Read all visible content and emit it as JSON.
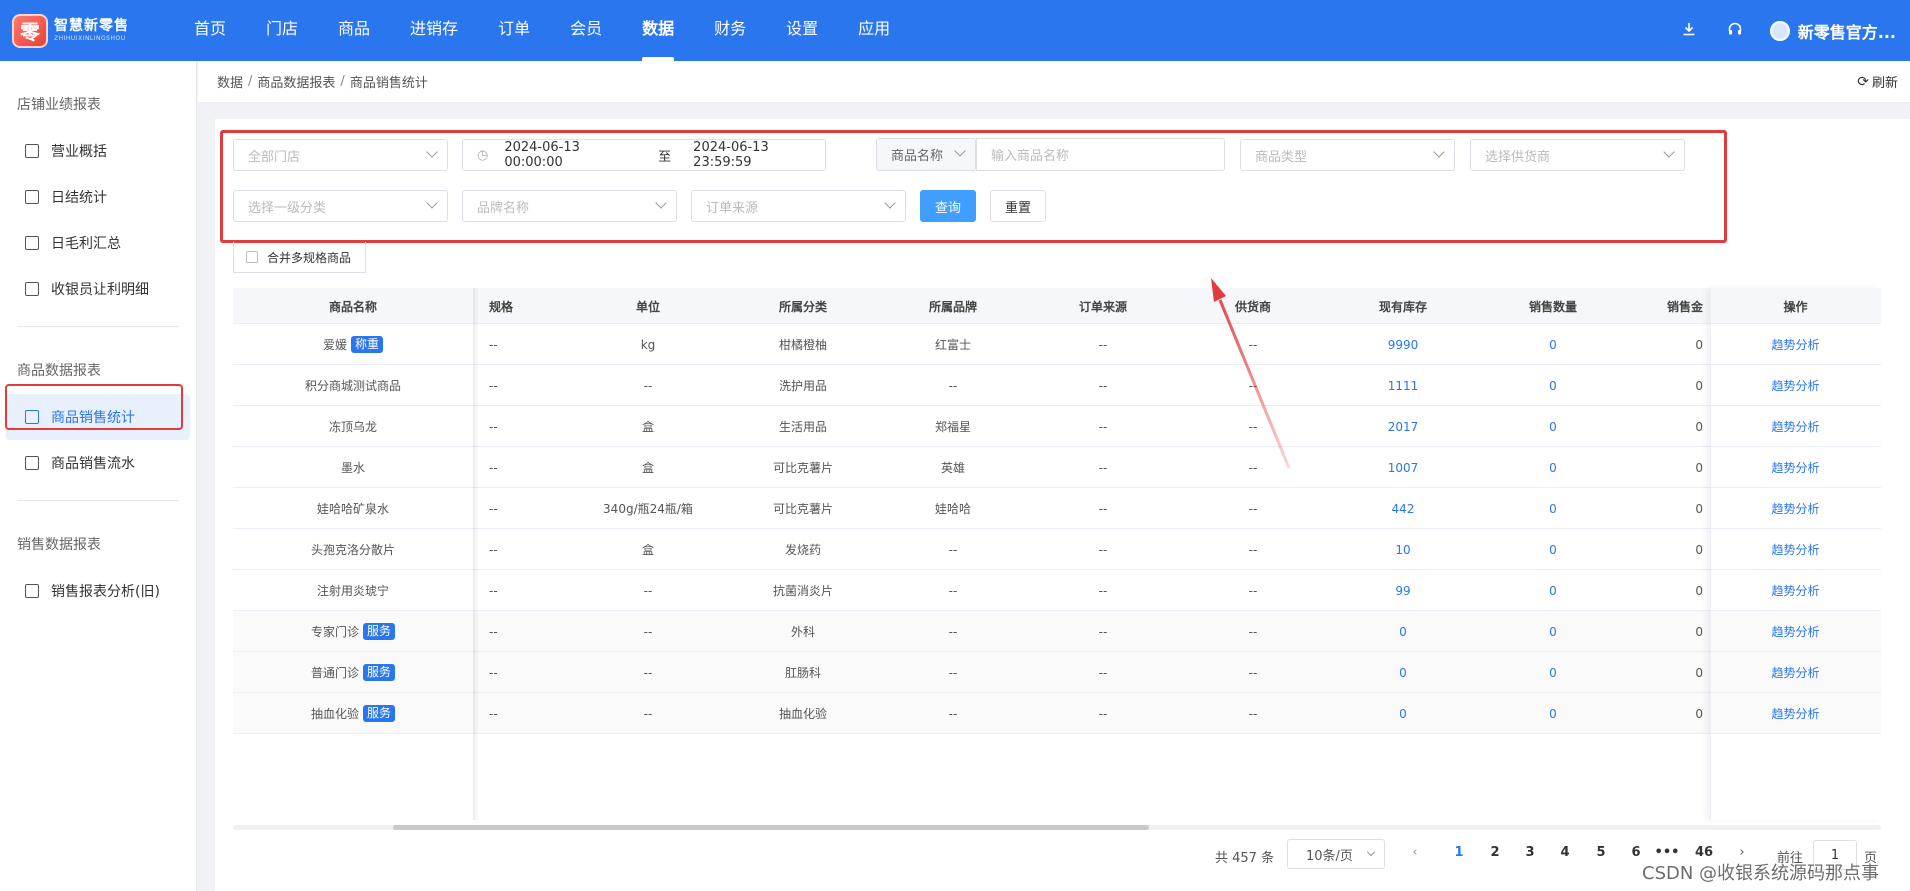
{
  "logo": {
    "badge": "零",
    "name_cn": "智慧新零售",
    "name_en": "ZHIHUIXINLINGSHOU"
  },
  "nav": [
    {
      "label": "首页"
    },
    {
      "label": "门店"
    },
    {
      "label": "商品"
    },
    {
      "label": "进销存"
    },
    {
      "label": "订单"
    },
    {
      "label": "会员"
    },
    {
      "label": "数据"
    },
    {
      "label": "财务"
    },
    {
      "label": "设置"
    },
    {
      "label": "应用"
    }
  ],
  "active_nav": "数据",
  "topright": {
    "download_icon": "download-icon",
    "support_icon": "headset-icon",
    "user_name": "新零售官方..."
  },
  "sidebar": {
    "group1": "店铺业绩报表",
    "group1_items": [
      {
        "label": "营业概括",
        "icon": "monitor-icon"
      },
      {
        "label": "日结统计",
        "icon": "pie-icon"
      },
      {
        "label": "日毛利汇总",
        "icon": "document-search-icon"
      },
      {
        "label": "收银员让利明细",
        "icon": "receipt-icon"
      }
    ],
    "group2": "商品数据报表",
    "group2_items": [
      {
        "label": "商品销售统计",
        "icon": "report-icon"
      },
      {
        "label": "商品销售流水",
        "icon": "list-icon"
      }
    ],
    "group3": "销售数据报表",
    "group3_items": [
      {
        "label": "销售报表分析(旧)",
        "icon": "line-chart-icon"
      }
    ]
  },
  "breadcrumb": [
    "数据",
    "商品数据报表",
    "商品销售统计"
  ],
  "refresh_label": "刷新",
  "filters": {
    "store_placeholder": "全部门店",
    "date_start": "2024-06-13 00:00:00",
    "date_sep": "至",
    "date_end": "2024-06-13 23:59:59",
    "name_field": "商品名称",
    "name_placeholder": "输入商品名称",
    "type_placeholder": "商品类型",
    "supplier_placeholder": "选择供货商",
    "category_placeholder": "选择一级分类",
    "brand_placeholder": "品牌名称",
    "source_placeholder": "订单来源",
    "query_label": "查询",
    "reset_label": "重置",
    "merge_label": "合并多规格商品"
  },
  "table": {
    "headers": [
      "商品名称",
      "规格",
      "单位",
      "所属分类",
      "所属品牌",
      "订单来源",
      "供货商",
      "现有库存",
      "销售数量",
      "销售金",
      "操作"
    ],
    "rows": [
      {
        "name": "爱媛",
        "tag": "称重",
        "spec": "--",
        "unit": "kg",
        "category": "柑橘橙柚",
        "brand": "红富士",
        "source": "--",
        "supplier": "--",
        "stock": "9990",
        "qty": "0",
        "amount": "0",
        "action": "趋势分析"
      },
      {
        "name": "积分商城测试商品",
        "tag": "",
        "spec": "--",
        "unit": "--",
        "category": "洗护用品",
        "brand": "--",
        "source": "--",
        "supplier": "--",
        "stock": "1111",
        "qty": "0",
        "amount": "0",
        "action": "趋势分析"
      },
      {
        "name": "冻顶乌龙",
        "tag": "",
        "spec": "--",
        "unit": "盒",
        "category": "生活用品",
        "brand": "郑福星",
        "source": "--",
        "supplier": "--",
        "stock": "2017",
        "qty": "0",
        "amount": "0",
        "action": "趋势分析"
      },
      {
        "name": "墨水",
        "tag": "",
        "spec": "--",
        "unit": "盒",
        "category": "可比克薯片",
        "brand": "英雄",
        "source": "--",
        "supplier": "--",
        "stock": "1007",
        "qty": "0",
        "amount": "0",
        "action": "趋势分析"
      },
      {
        "name": "娃哈哈矿泉水",
        "tag": "",
        "spec": "--",
        "unit": "340g/瓶24瓶/箱",
        "category": "可比克薯片",
        "brand": "娃哈哈",
        "source": "--",
        "supplier": "--",
        "stock": "442",
        "qty": "0",
        "amount": "0",
        "action": "趋势分析"
      },
      {
        "name": "头孢克洛分散片",
        "tag": "",
        "spec": "--",
        "unit": "盒",
        "category": "发烧药",
        "brand": "--",
        "source": "--",
        "supplier": "--",
        "stock": "10",
        "qty": "0",
        "amount": "0",
        "action": "趋势分析"
      },
      {
        "name": "注射用炎琥宁",
        "tag": "",
        "spec": "--",
        "unit": "--",
        "category": "抗菌消炎片",
        "brand": "--",
        "source": "--",
        "supplier": "--",
        "stock": "99",
        "qty": "0",
        "amount": "0",
        "action": "趋势分析"
      },
      {
        "name": "专家门诊",
        "tag": "服务",
        "spec": "--",
        "unit": "--",
        "category": "外科",
        "brand": "--",
        "source": "--",
        "supplier": "--",
        "stock": "0",
        "qty": "0",
        "amount": "0",
        "action": "趋势分析"
      },
      {
        "name": "普通门诊",
        "tag": "服务",
        "spec": "--",
        "unit": "--",
        "category": "肛肠科",
        "brand": "--",
        "source": "--",
        "supplier": "--",
        "stock": "0",
        "qty": "0",
        "amount": "0",
        "action": "趋势分析"
      },
      {
        "name": "抽血化验",
        "tag": "服务",
        "spec": "--",
        "unit": "--",
        "category": "抽血化验",
        "brand": "--",
        "source": "--",
        "supplier": "--",
        "stock": "0",
        "qty": "0",
        "amount": "0",
        "action": "趋势分析"
      }
    ]
  },
  "pagination": {
    "total": "共 457 条",
    "page_size": "10条/页",
    "pages": [
      "1",
      "2",
      "3",
      "4",
      "5",
      "6"
    ],
    "ellipsis": "•••",
    "last_page": "46",
    "current": "1",
    "goto_label": "前往",
    "goto_value": "1",
    "page_suffix": "页"
  },
  "watermark": "CSDN @收银系统源码那点事",
  "colors": {
    "primary": "#2a76ee",
    "button": "#409eff",
    "annotation": "#e23b3b"
  }
}
